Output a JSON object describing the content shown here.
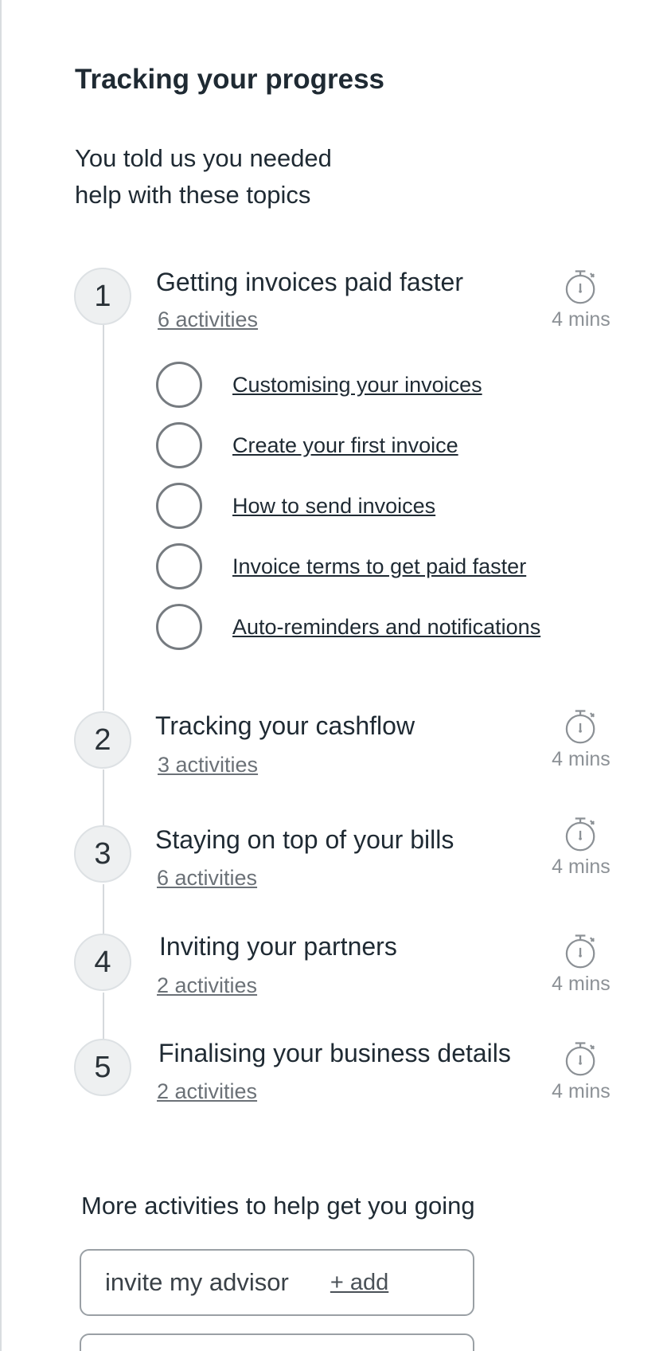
{
  "header": {
    "title": "Tracking your progress",
    "intro_line1": "You told us you needed",
    "intro_line2": "help with these topics"
  },
  "topics": [
    {
      "number": "1",
      "title": "Getting invoices paid faster",
      "activities": "6 activities",
      "duration": "4 mins",
      "items": [
        "Customising your invoices",
        "Create your first invoice",
        "How to send invoices",
        "Invoice terms to get paid faster",
        "Auto-reminders and notifications"
      ]
    },
    {
      "number": "2",
      "title": "Tracking your cashflow",
      "activities": "3 activities",
      "duration": "4 mins"
    },
    {
      "number": "3",
      "title": "Staying on top of your bills",
      "activities": "6 activities",
      "duration": "4 mins"
    },
    {
      "number": "4",
      "title": "Inviting your partners",
      "activities": "2 activities",
      "duration": "4 mins"
    },
    {
      "number": "5",
      "title": "Finalising your business details",
      "activities": "2 activities",
      "duration": "4 mins"
    }
  ],
  "more": {
    "heading": "More activities to help get you going",
    "cards": [
      {
        "label": "invite my advisor",
        "action": "+ add"
      }
    ]
  },
  "icons": {
    "timer": "stopwatch-icon",
    "status": "empty-circle-icon"
  }
}
